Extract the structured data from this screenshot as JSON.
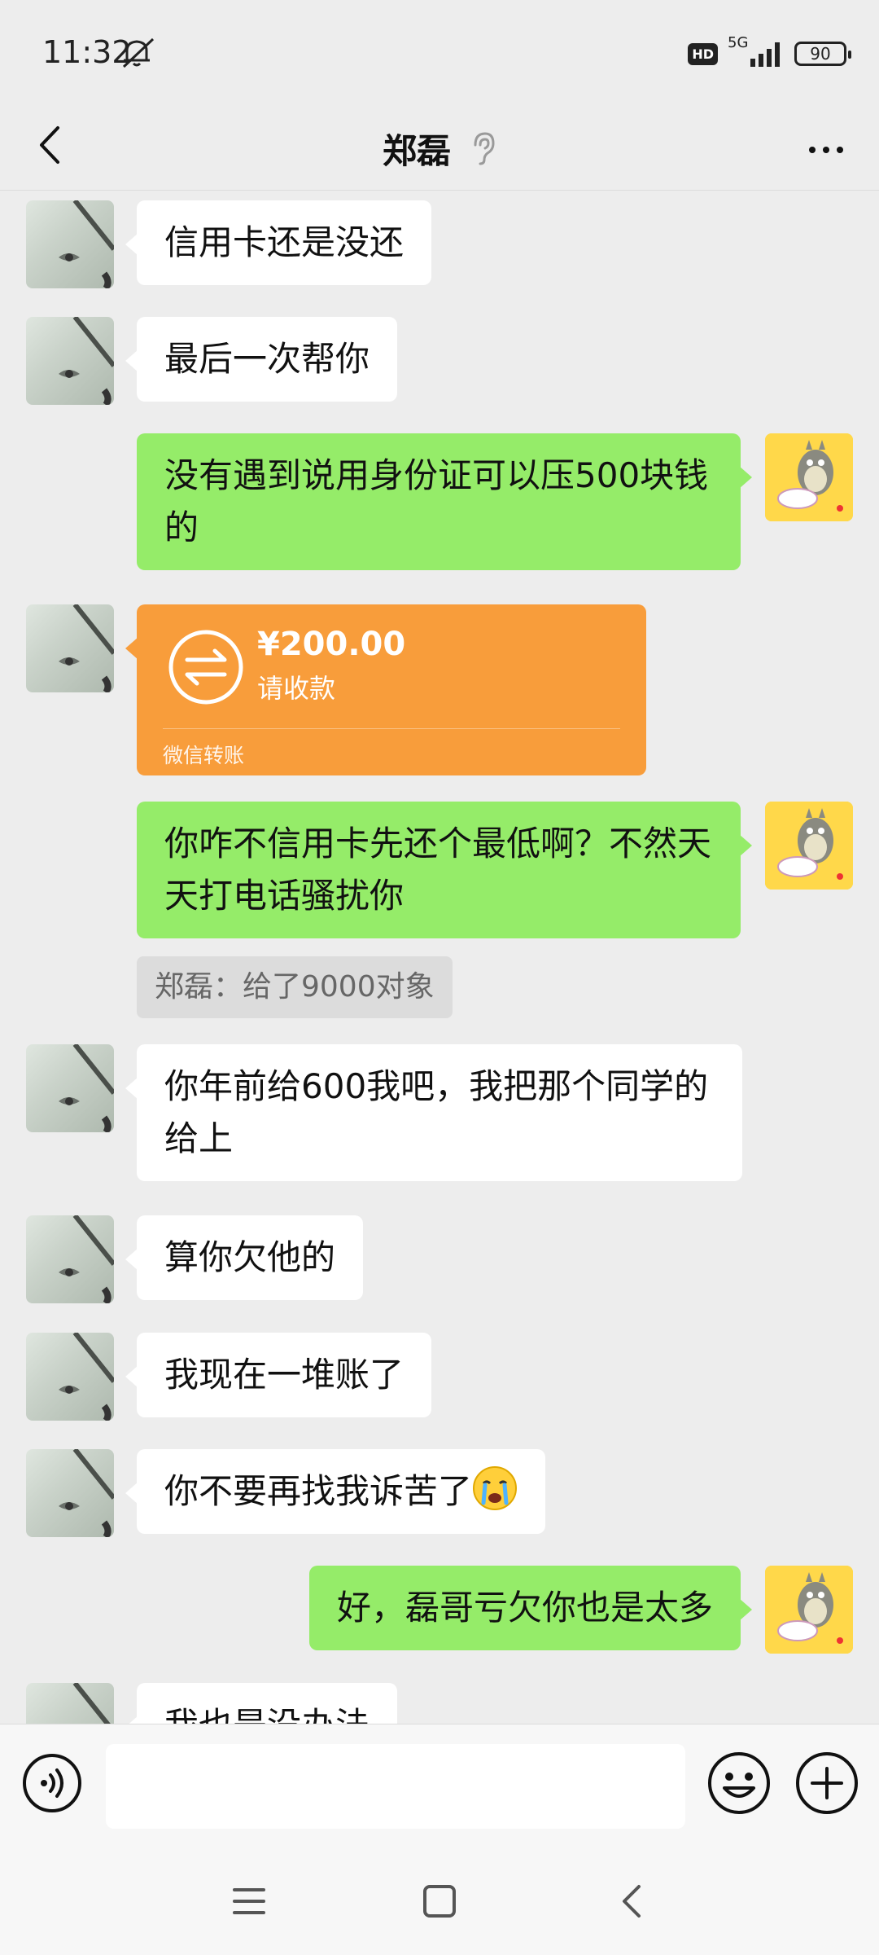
{
  "status_bar": {
    "time": "11:32",
    "hd": "HD",
    "network": "5G",
    "battery": "90"
  },
  "nav": {
    "title": "郑磊"
  },
  "messages": [
    {
      "text": "信用卡还是没还"
    },
    {
      "text": "最后一次帮你"
    },
    {
      "text": "没有遇到说用身份证可以压500块钱的"
    },
    {
      "transfer_amount": "¥200.00",
      "transfer_status": "请收款",
      "transfer_footer": "微信转账"
    },
    {
      "text": "你咋不信用卡先还个最低啊？不然天天打电话骚扰你"
    },
    {
      "quote": "郑磊：给了9000对象"
    },
    {
      "text": "你年前给600我吧，我把那个同学的给上"
    },
    {
      "text": "算你欠他的"
    },
    {
      "text": "我现在一堆账了"
    },
    {
      "text": "你不要再找我诉苦了"
    },
    {
      "text": "好，磊哥亏欠你也是太多"
    },
    {
      "text": "我也是没办法"
    }
  ],
  "colors": {
    "background": "#ededed",
    "self_bubble": "#95ec69",
    "friend_bubble": "#ffffff",
    "transfer_card": "#f89d3b"
  }
}
